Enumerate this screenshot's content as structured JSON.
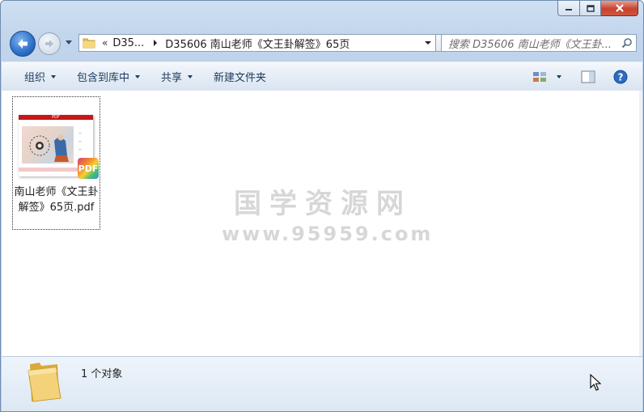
{
  "window": {
    "caption_buttons": {
      "minimize": "minimize-icon",
      "maximize": "maximize-icon",
      "close": "close-icon"
    }
  },
  "address": {
    "overflow_chevron": "«",
    "crumbs": [
      "D35...",
      "D35606 南山老师《文王卦解签》65页"
    ],
    "refresh_icon": "⇆"
  },
  "search": {
    "placeholder": "搜索 D35606 南山老师《文王卦..."
  },
  "toolbar": {
    "organize": "组织",
    "include_in_library": "包含到库中",
    "share": "共享",
    "new_folder": "新建文件夹"
  },
  "file": {
    "name": "南山老师《文王卦解签》65页.pdf",
    "thumb_header": "PDF",
    "badge": "PDF"
  },
  "watermark": {
    "title": "国学资源网",
    "url": "www.95959.com"
  },
  "details": {
    "count": "1 个对象"
  },
  "colors": {
    "accent": "#2a6fc9",
    "close_button": "#c7432f",
    "toolbar_text": "#1e3b5e",
    "pdf_red": "#c71616"
  }
}
